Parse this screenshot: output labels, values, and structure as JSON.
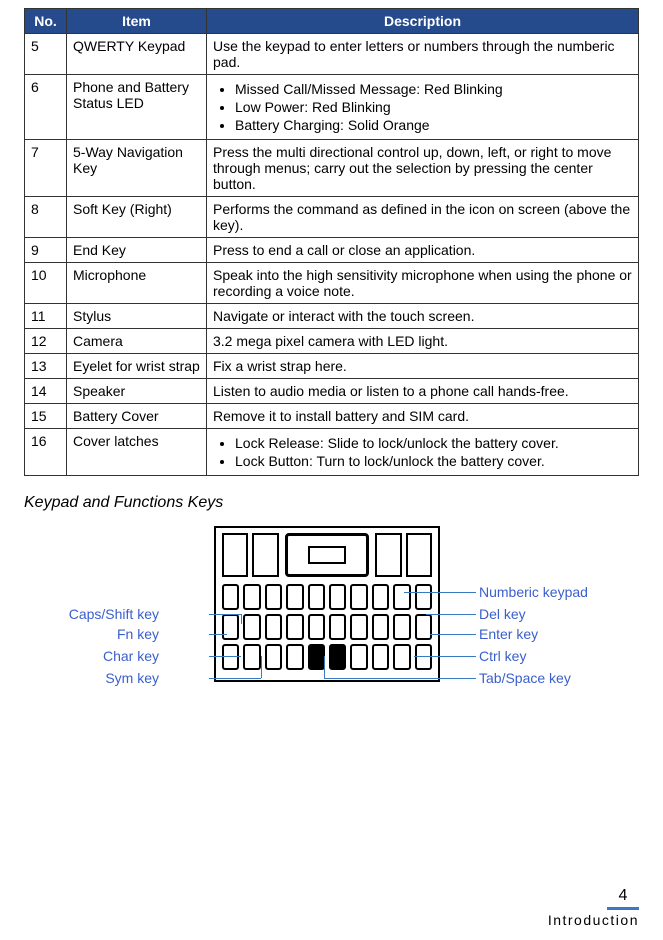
{
  "table": {
    "headers": {
      "no": "No.",
      "item": "Item",
      "desc": "Description"
    },
    "rows": [
      {
        "no": "5",
        "item": "QWERTY Keypad",
        "desc_text": "Use the keypad to enter letters or numbers through the numberic pad."
      },
      {
        "no": "6",
        "item": "Phone and Battery Status LED",
        "desc_list": [
          "Missed Call/Missed Message: Red Blinking",
          "Low Power: Red Blinking",
          "Battery Charging: Solid Orange"
        ]
      },
      {
        "no": "7",
        "item": "5-Way Navigation Key",
        "desc_text": "Press the multi directional control up, down, left, or right to move through menus; carry out the selection by pressing the center button."
      },
      {
        "no": "8",
        "item": "Soft Key (Right)",
        "desc_text": "Performs the command as defined in the icon on screen (above the key)."
      },
      {
        "no": "9",
        "item": "End Key",
        "desc_text": "Press to end a call or close an application."
      },
      {
        "no": "10",
        "item": "Microphone",
        "desc_text": "Speak into the high sensitivity microphone when using the phone or recording a voice note."
      },
      {
        "no": "11",
        "item": "Stylus",
        "desc_text": "Navigate or interact with the touch screen."
      },
      {
        "no": "12",
        "item": "Camera",
        "desc_text": "3.2 mega pixel camera with LED light."
      },
      {
        "no": "13",
        "item": "Eyelet for wrist strap",
        "desc_text": "Fix a wrist strap here."
      },
      {
        "no": "14",
        "item": "Speaker",
        "desc_text": "Listen to audio media or listen to a phone call hands-free."
      },
      {
        "no": "15",
        "item": "Battery Cover",
        "desc_text": "Remove it to install battery and SIM card."
      },
      {
        "no": "16",
        "item": "Cover latches",
        "desc_list": [
          "Lock Release: Slide to lock/unlock the battery cover.",
          "Lock Button: Turn to lock/unlock the battery cover."
        ]
      }
    ]
  },
  "section_title": "Keypad and Functions Keys",
  "callouts": {
    "left": [
      "Caps/Shift key",
      "Fn key",
      "Char key",
      "Sym key"
    ],
    "right": [
      "Numberic keypad",
      "Del key",
      "Enter key",
      "Ctrl key",
      "Tab/Space key"
    ]
  },
  "footer": {
    "page": "4",
    "title": "Introduction"
  }
}
